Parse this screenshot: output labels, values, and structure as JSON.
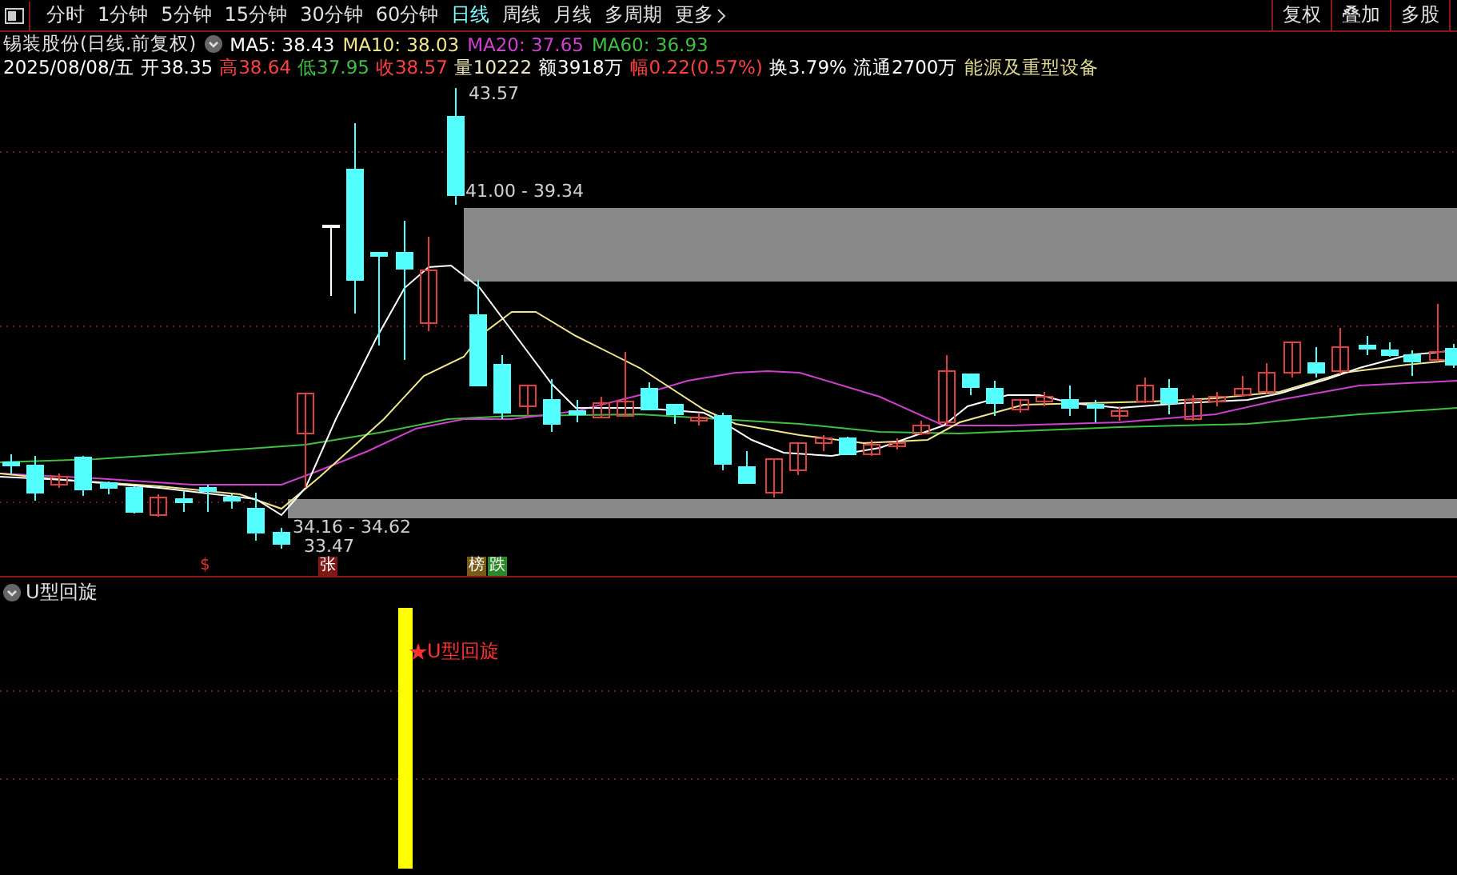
{
  "toolbar": {
    "periods": [
      {
        "label": "分时",
        "selected": false
      },
      {
        "label": "1分钟",
        "selected": false
      },
      {
        "label": "5分钟",
        "selected": false
      },
      {
        "label": "15分钟",
        "selected": false
      },
      {
        "label": "30分钟",
        "selected": false
      },
      {
        "label": "60分钟",
        "selected": false
      },
      {
        "label": "日线",
        "selected": true
      },
      {
        "label": "周线",
        "selected": false
      },
      {
        "label": "月线",
        "selected": false
      },
      {
        "label": "多周期",
        "selected": false
      },
      {
        "label": "更多",
        "selected": false
      }
    ],
    "actions": [
      "复权",
      "叠加",
      "多股"
    ]
  },
  "quote": {
    "title": "锡装股份(日线.前复权)",
    "moving_averages": [
      {
        "label": "MA5: 38.43",
        "color": "#ffffff"
      },
      {
        "label": "MA10: 38.03",
        "color": "#f0e68c"
      },
      {
        "label": "MA20: 37.65",
        "color": "#d040d0"
      },
      {
        "label": "MA60: 36.93",
        "color": "#40c040"
      }
    ],
    "stats": [
      {
        "text": "2025/08/08/五",
        "color": "#ffffff"
      },
      {
        "text": "开38.35",
        "color": "#ffffff"
      },
      {
        "text": "高38.64",
        "color": "#ff4040"
      },
      {
        "text": "低37.95",
        "color": "#40c040"
      },
      {
        "text": "收38.57",
        "color": "#ff4040"
      },
      {
        "text": "量10222",
        "color": "#f0e8c0"
      },
      {
        "text": "额3918万",
        "color": "#ffffff"
      },
      {
        "text": "幅0.22(0.57%)",
        "color": "#ff4040"
      },
      {
        "text": "换3.79%",
        "color": "#ffffff"
      },
      {
        "text": "流通2700万",
        "color": "#ffffff"
      },
      {
        "text": "能源及重型设备",
        "color": "#e0d890"
      }
    ]
  },
  "chart": {
    "high_label": "43.57",
    "upper_zone_label": "41.00 - 39.34",
    "lower_zone_label": "34.16 - 34.62",
    "low_label": "33.47",
    "markers": [
      {
        "text": "$",
        "color": "#e03030",
        "kind": "plain"
      },
      {
        "text": "张",
        "color": "#801818",
        "kind": "tag"
      },
      {
        "text": "榜",
        "color": "#7a5a1a",
        "kind": "tag"
      },
      {
        "text": "跌",
        "color": "#2a8a2a",
        "kind": "tag"
      }
    ]
  },
  "indicator": {
    "name": "U型回旋",
    "signal_label": "U型回旋"
  }
}
